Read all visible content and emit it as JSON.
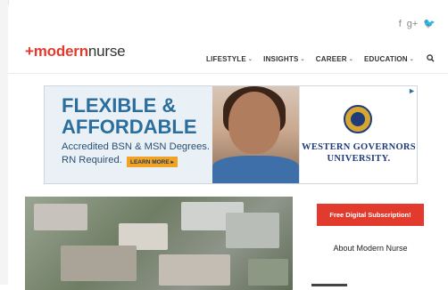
{
  "social": {
    "icons": [
      "facebook-icon",
      "google-plus-icon",
      "twitter-icon"
    ],
    "glyphs": [
      "f",
      "g+",
      "🐦"
    ]
  },
  "header": {
    "logo_plus": "+",
    "logo_modern": "modern",
    "logo_nurse": "nurse",
    "nav": [
      {
        "label": "LIFESTYLE"
      },
      {
        "label": "INSIGHTS"
      },
      {
        "label": "CAREER"
      },
      {
        "label": "EDUCATION"
      }
    ],
    "chevron": "⌄"
  },
  "ad": {
    "headline_line1": "FLEXIBLE &",
    "headline_line2": "AFFORDABLE",
    "sub_line1": "Accredited BSN & MSN Degrees.",
    "sub_line2": "RN Required.",
    "cta": "LEARN MORE ▸",
    "university_line1": "WESTERN GOVERNORS",
    "university_line2": "UNIVERSITY."
  },
  "sidebar": {
    "subscribe_label": "Free Digital Subscription!",
    "about_label": "About Modern Nurse"
  },
  "colors": {
    "brand_red": "#e23b2e",
    "ad_blue": "#2b6d9c",
    "wgu_navy": "#1f3b7a",
    "cta_orange": "#f2a324"
  }
}
